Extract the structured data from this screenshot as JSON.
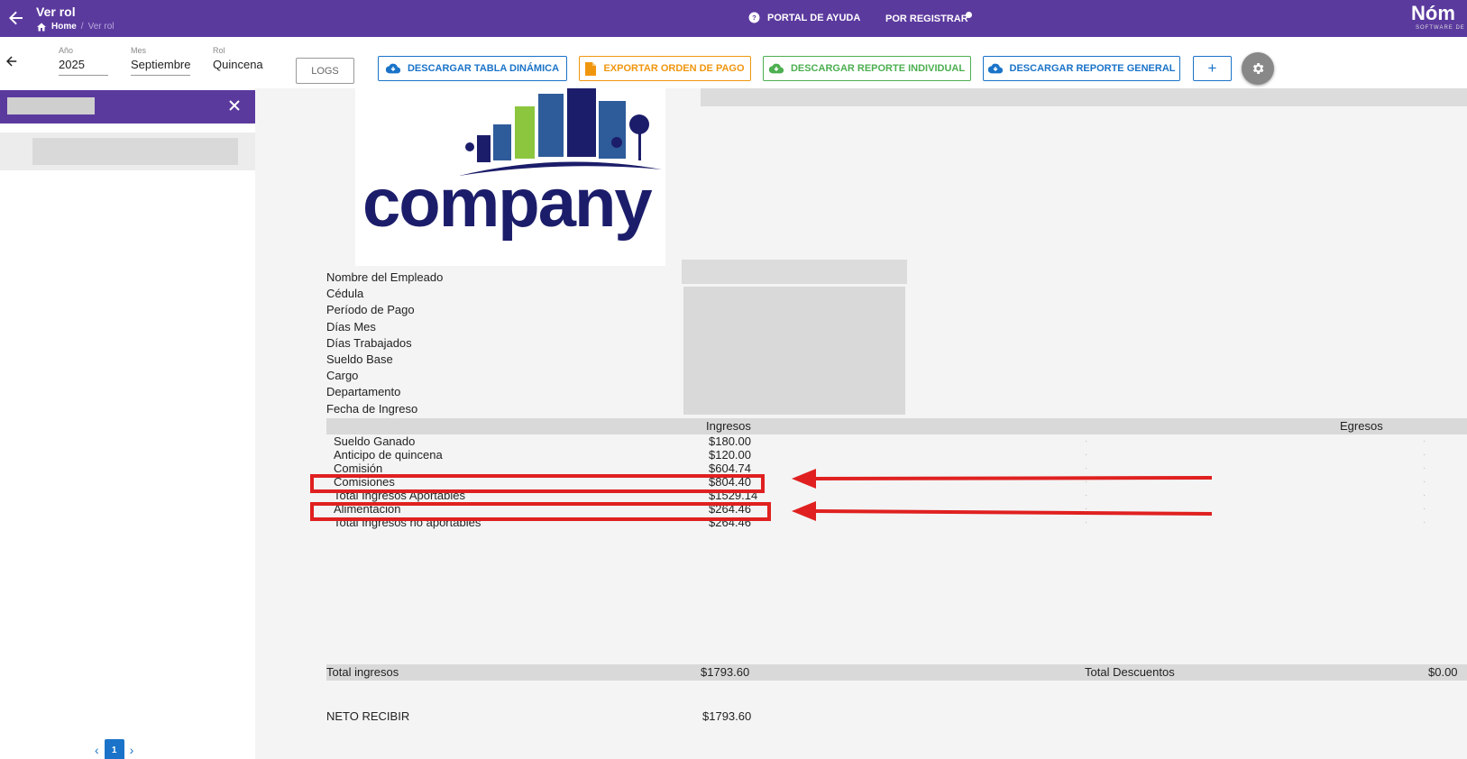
{
  "header": {
    "title": "Ver rol",
    "breadcrumb": {
      "home": "Home",
      "separator": "/",
      "current": "Ver rol"
    },
    "help_label": "PORTAL DE AYUDA",
    "register_label": "POR REGISTRAR",
    "brand": "Nóm",
    "brand_sub": "SOFTWARE DE"
  },
  "filters": {
    "year": {
      "label": "Año",
      "value": "2025"
    },
    "month": {
      "label": "Mes",
      "value": "Septiembre"
    },
    "role": {
      "label": "Rol",
      "value": "Quincena"
    }
  },
  "actions": {
    "logs": "LOGS",
    "pivot": "DESCARGAR TABLA DINÁMICA",
    "payment_order": "EXPORTAR ORDEN DE PAGO",
    "individual_report": "DESCARGAR REPORTE INDIVIDUAL",
    "general_report": "DESCARGAR REPORTE GENERAL",
    "add": "+"
  },
  "sidebar": {
    "pagination": {
      "prev": "‹",
      "page": "1",
      "next": "›"
    }
  },
  "payslip": {
    "logo_text": "company",
    "info_labels": [
      "Nombre del Empleado",
      "Cédula",
      "Período de Pago",
      "Días Mes",
      "Días Trabajados",
      "Sueldo Base",
      "Cargo",
      "Departamento",
      "Fecha de Ingreso"
    ],
    "income_header": "Ingresos",
    "expense_header": "Egresos",
    "income_rows": [
      {
        "label": "Sueldo Ganado",
        "value": "$180.00"
      },
      {
        "label": "Anticipo de quincena",
        "value": "$120.00"
      },
      {
        "label": "Comisión",
        "value": "$604.74"
      },
      {
        "label": "Comisiones",
        "value": "$804.40"
      },
      {
        "label": "Total Ingresos Aportables",
        "value": "$1529.14"
      },
      {
        "label": "Alimentacion",
        "value": "$264.46"
      },
      {
        "label": "Total Ingresos no aportables",
        "value": "$264.46"
      }
    ],
    "total_income_label": "Total ingresos",
    "total_income_value": "$1793.60",
    "total_discounts_label": "Total Descuentos",
    "total_discounts_value": "$0.00",
    "net_label": "NETO RECIBIR",
    "net_value": "$1793.60"
  },
  "colors": {
    "primary": "#5b3a9e",
    "highlight": "#e02020",
    "accent_blue": "#1a73c8",
    "accent_orange": "#f0960e",
    "accent_green": "#4caf50"
  }
}
